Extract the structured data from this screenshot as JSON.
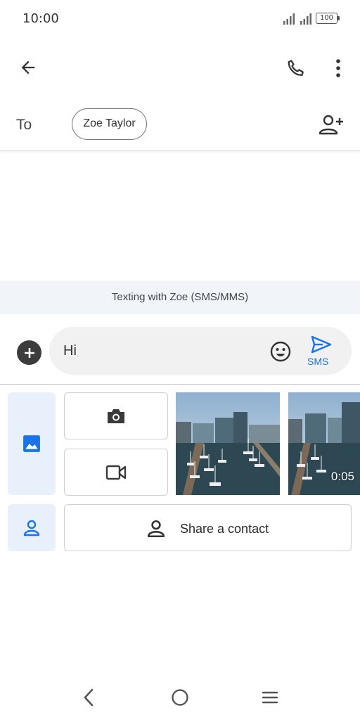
{
  "status_bar": {
    "time": "10:00",
    "battery": "100",
    "icons": [
      "signal-icon",
      "signal-icon",
      "battery-icon"
    ]
  },
  "toolbar": {
    "back_icon": "arrow-back-icon",
    "call_icon": "phone-icon",
    "more_icon": "more-vert-icon"
  },
  "recipients": {
    "to_label": "To",
    "chips": [
      "Zoe Taylor"
    ],
    "add_icon": "add-person-icon"
  },
  "conversation": {
    "banner": "Texting with Zoe (SMS/MMS)"
  },
  "compose": {
    "message_text": "Hi",
    "send_label": "SMS",
    "add_icon": "plus-circle-icon",
    "emoji_icon": "emoji-icon",
    "send_icon": "send-icon"
  },
  "attachments": {
    "gallery_tab_icon": "image-icon",
    "contact_tab_icon": "person-icon",
    "camera_icon": "camera-icon",
    "video_icon": "videocam-icon",
    "media": [
      {
        "type": "photo",
        "description": "marina-with-boats"
      },
      {
        "type": "video",
        "duration": "0:05"
      }
    ],
    "share_contact_label": "Share a contact"
  },
  "colors": {
    "accent": "#1a73e8",
    "tab_background": "#e8f0fb",
    "compose_background": "#f1f1f1",
    "banner_background": "#f1f5f9"
  },
  "nav_bar": {
    "icons": [
      "nav-back-icon",
      "nav-home-icon",
      "nav-menu-icon"
    ]
  }
}
